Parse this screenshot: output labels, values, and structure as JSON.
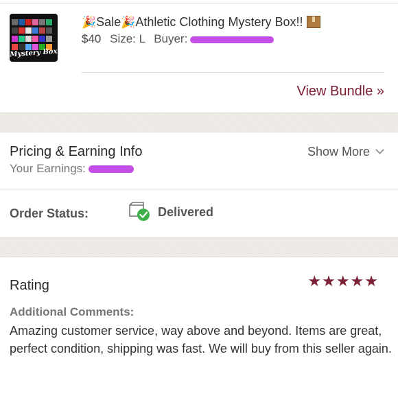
{
  "item": {
    "title_sale": "Sale",
    "title_main": "Athletic Clothing Mystery Box!!",
    "thumbnail_text": "Mystery Box",
    "price": "$40",
    "size": "Size: L",
    "buyer_label": "Buyer:",
    "view_bundle": "View Bundle »"
  },
  "pricing": {
    "title": "Pricing & Earning Info",
    "earnings_label": "Your Earnings:",
    "show_more": "Show More"
  },
  "order": {
    "label": "Order Status:",
    "status": "Delivered"
  },
  "rating": {
    "title": "Rating",
    "stars": "★★★★★",
    "star_count": 5,
    "comments_label": "Additional Comments:",
    "comments": "Amazing customer service, way above and beyond. Items are great, perfect condition, shipping was fast. We will buy from this seller again."
  },
  "colors": {
    "accent": "#7b2135",
    "redaction": "#c44ee6",
    "delivered_check": "#3fb04a",
    "section_gap": "#efece7"
  },
  "icons": {
    "party": "party-popper-icon",
    "box": "package-icon",
    "delivered": "delivered-box-check-icon",
    "chevron": "chevron-down-icon"
  }
}
